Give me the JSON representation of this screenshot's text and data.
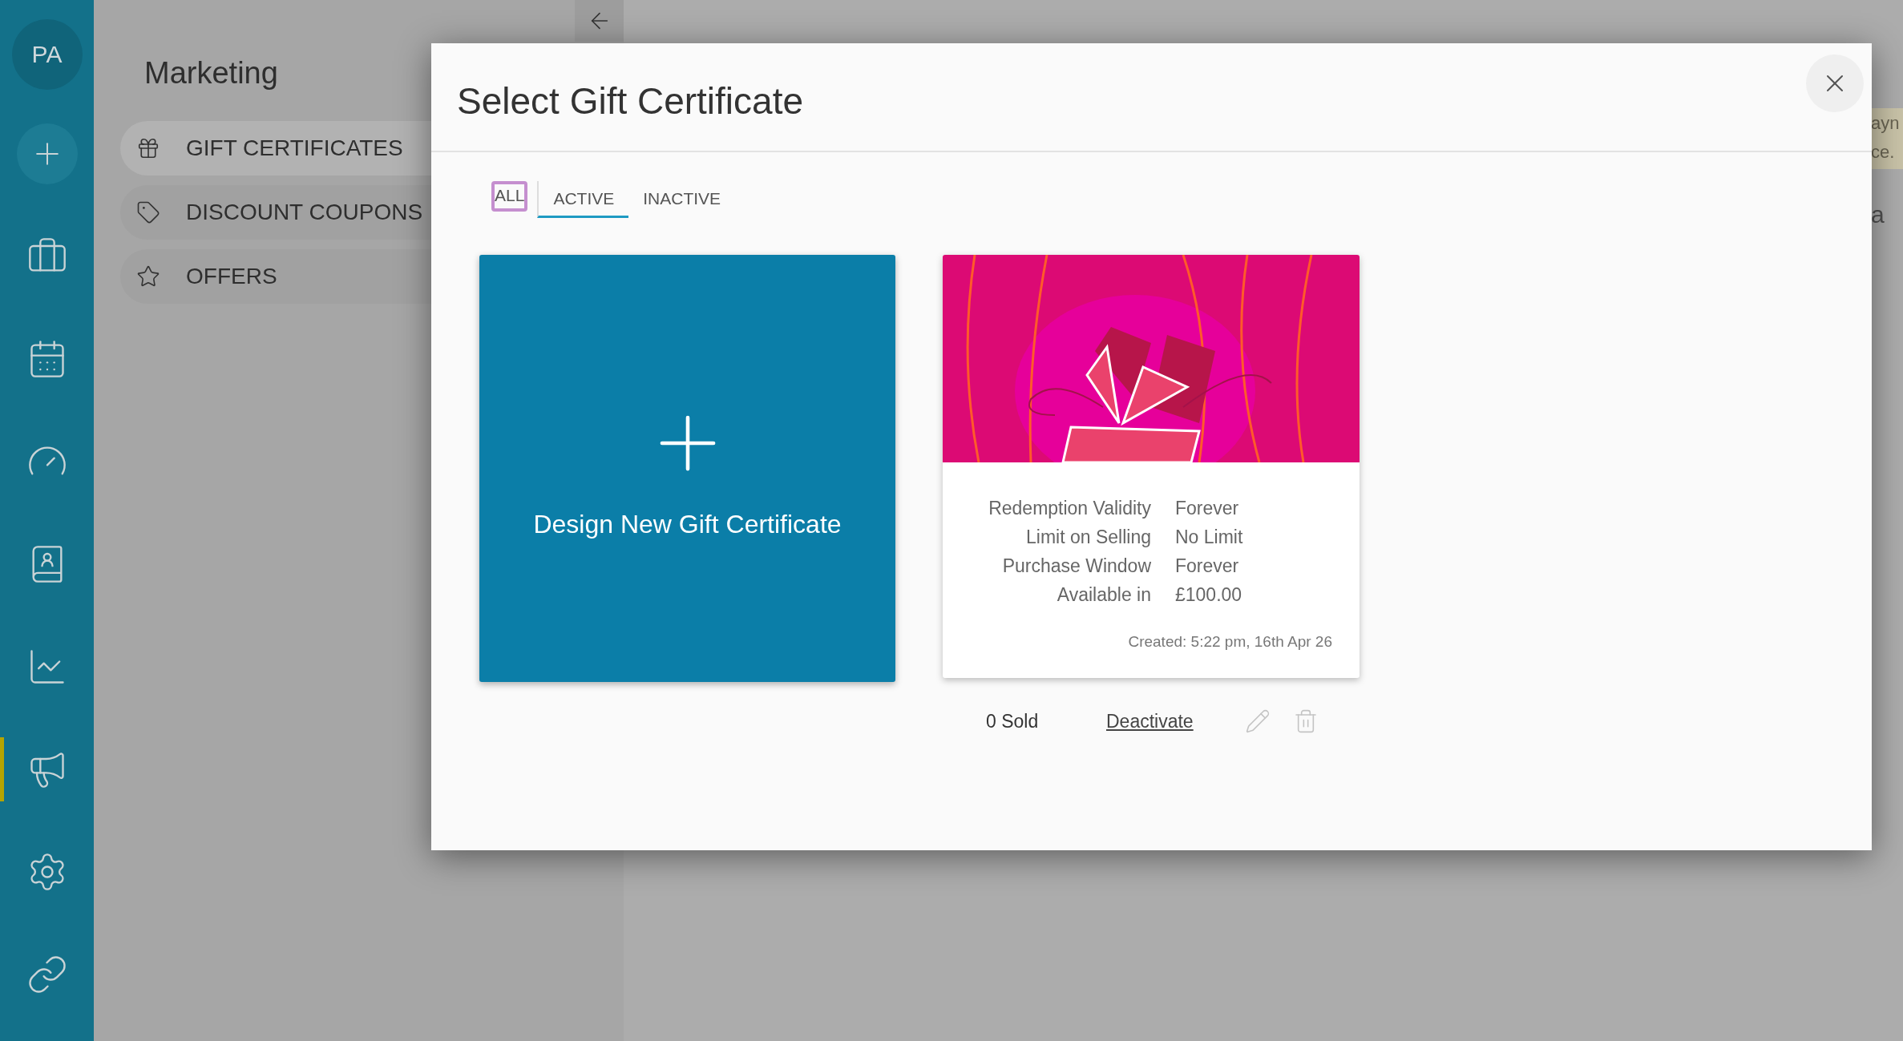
{
  "sidebar": {
    "avatar": "PA",
    "items": [
      {
        "kind": "add",
        "selected": false
      },
      {
        "kind": "briefcase",
        "selected": false
      },
      {
        "kind": "calendar",
        "selected": false
      },
      {
        "kind": "gauge",
        "selected": false
      },
      {
        "kind": "contacts",
        "selected": false
      },
      {
        "kind": "chart",
        "selected": false
      },
      {
        "kind": "megaphone",
        "selected": true
      },
      {
        "kind": "settings",
        "selected": false
      },
      {
        "kind": "link",
        "selected": false
      }
    ]
  },
  "marketing": {
    "title": "Marketing",
    "items": [
      {
        "label": "GIFT CERTIFICATES",
        "kind": "gift",
        "selected": true
      },
      {
        "label": "DISCOUNT COUPONS",
        "kind": "tag",
        "selected": false
      },
      {
        "label": "OFFERS",
        "kind": "star",
        "selected": false
      }
    ]
  },
  "behind_modal": {
    "notice_lines": [
      "ayn",
      "ce."
    ],
    "text_fragment": "a"
  },
  "modal": {
    "title": "Select Gift Certificate",
    "tabs": [
      {
        "label": "ALL",
        "selected": false,
        "focused": true
      },
      {
        "label": "ACTIVE",
        "selected": true,
        "focused": false
      },
      {
        "label": "INACTIVE",
        "selected": false,
        "focused": false
      }
    ],
    "new_card": {
      "label": "Design New Gift Certificate"
    },
    "certificates": [
      {
        "details": [
          {
            "label": "Redemption Validity",
            "value": "Forever"
          },
          {
            "label": "Limit on Selling",
            "value": "No Limit"
          },
          {
            "label": "Purchase Window",
            "value": "Forever"
          },
          {
            "label": "Available in",
            "value": "£100.00"
          }
        ],
        "created": "Created: 5:22 pm, 16th Apr 26",
        "sold": "0 Sold",
        "action": "Deactivate"
      }
    ]
  }
}
